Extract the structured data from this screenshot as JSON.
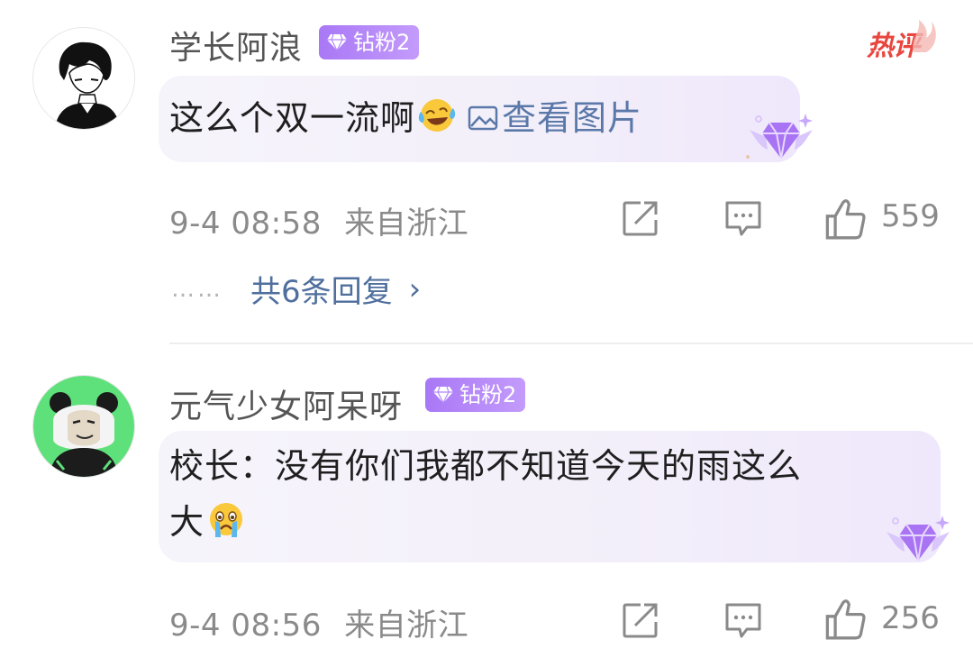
{
  "comments": [
    {
      "username": "学长阿浪",
      "badge": "钻粉2",
      "hot_label": "热评",
      "text": "这么个双一流啊",
      "image_link": "查看图片",
      "time": "9-4 08:58",
      "location": "来自浙江",
      "likes": "559",
      "replies_text": "共6条回复",
      "replies_dots": "……"
    },
    {
      "username": "元气少女阿呆呀",
      "badge": "钻粉2",
      "text_line1": "校长：没有你们我都不知道今天的雨这么",
      "text_line2": "大",
      "time": "9-4 08:56",
      "location": "来自浙江",
      "likes": "256"
    }
  ],
  "icons": [
    "avatar-boy",
    "avatar-panda",
    "diamond-badge-icon",
    "laugh-cry-emoji",
    "image-icon",
    "crying-emoji",
    "share-icon",
    "comment-icon",
    "like-icon",
    "chevron-right-icon",
    "hot-comment-flame-icon",
    "diamond-wings-decoration"
  ],
  "colors": {
    "badge_purple": "#b388fa",
    "link_blue": "#4f6f9e",
    "hot_red": "#e8463f",
    "bubble_bg": "#f4f1fa",
    "meta_gray": "#8a8a8a"
  }
}
